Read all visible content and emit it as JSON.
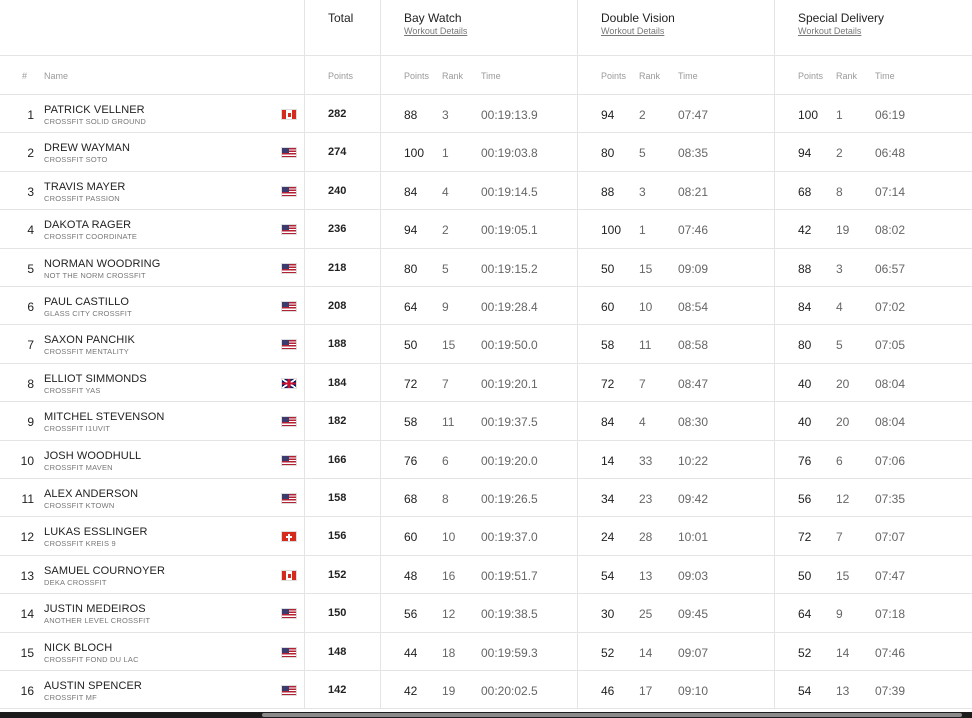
{
  "header": {
    "total_label": "Total",
    "events": [
      {
        "name": "Bay Watch",
        "link": "Workout Details"
      },
      {
        "name": "Double Vision",
        "link": "Workout Details"
      },
      {
        "name": "Special Delivery",
        "link": "Workout Details"
      }
    ]
  },
  "subheader": {
    "hash": "#",
    "name": "Name",
    "points": "Points",
    "ev_points": "Points",
    "ev_rank": "Rank",
    "ev_time": "Time"
  },
  "athletes": [
    {
      "rank": "1",
      "name": "PATRICK VELLNER",
      "affiliate": "CROSSFIT SOLID GROUND",
      "flag": "canada-flag",
      "total": "282",
      "events": [
        {
          "points": "88",
          "rank": "3",
          "time": "00:19:13.9"
        },
        {
          "points": "94",
          "rank": "2",
          "time": "07:47"
        },
        {
          "points": "100",
          "rank": "1",
          "time": "06:19"
        }
      ]
    },
    {
      "rank": "2",
      "name": "DREW WAYMAN",
      "affiliate": "CROSSFIT SOTO",
      "flag": "usa-flag",
      "total": "274",
      "events": [
        {
          "points": "100",
          "rank": "1",
          "time": "00:19:03.8"
        },
        {
          "points": "80",
          "rank": "5",
          "time": "08:35"
        },
        {
          "points": "94",
          "rank": "2",
          "time": "06:48"
        }
      ]
    },
    {
      "rank": "3",
      "name": "TRAVIS MAYER",
      "affiliate": "CROSSFIT PASSION",
      "flag": "usa-flag",
      "total": "240",
      "events": [
        {
          "points": "84",
          "rank": "4",
          "time": "00:19:14.5"
        },
        {
          "points": "88",
          "rank": "3",
          "time": "08:21"
        },
        {
          "points": "68",
          "rank": "8",
          "time": "07:14"
        }
      ]
    },
    {
      "rank": "4",
      "name": "DAKOTA RAGER",
      "affiliate": "CROSSFIT COORDINATE",
      "flag": "usa-flag",
      "total": "236",
      "events": [
        {
          "points": "94",
          "rank": "2",
          "time": "00:19:05.1"
        },
        {
          "points": "100",
          "rank": "1",
          "time": "07:46"
        },
        {
          "points": "42",
          "rank": "19",
          "time": "08:02"
        }
      ]
    },
    {
      "rank": "5",
      "name": "NORMAN WOODRING",
      "affiliate": "NOT THE NORM CROSSFIT",
      "flag": "usa-flag",
      "total": "218",
      "events": [
        {
          "points": "80",
          "rank": "5",
          "time": "00:19:15.2"
        },
        {
          "points": "50",
          "rank": "15",
          "time": "09:09"
        },
        {
          "points": "88",
          "rank": "3",
          "time": "06:57"
        }
      ]
    },
    {
      "rank": "6",
      "name": "PAUL CASTILLO",
      "affiliate": "GLASS CITY CROSSFIT",
      "flag": "usa-flag",
      "total": "208",
      "events": [
        {
          "points": "64",
          "rank": "9",
          "time": "00:19:28.4"
        },
        {
          "points": "60",
          "rank": "10",
          "time": "08:54"
        },
        {
          "points": "84",
          "rank": "4",
          "time": "07:02"
        }
      ]
    },
    {
      "rank": "7",
      "name": "SAXON PANCHIK",
      "affiliate": "CROSSFIT MENTALITY",
      "flag": "usa-flag",
      "total": "188",
      "events": [
        {
          "points": "50",
          "rank": "15",
          "time": "00:19:50.0"
        },
        {
          "points": "58",
          "rank": "11",
          "time": "08:58"
        },
        {
          "points": "80",
          "rank": "5",
          "time": "07:05"
        }
      ]
    },
    {
      "rank": "8",
      "name": "ELLIOT SIMMONDS",
      "affiliate": "CROSSFIT YAS",
      "flag": "uk-flag",
      "total": "184",
      "events": [
        {
          "points": "72",
          "rank": "7",
          "time": "00:19:20.1"
        },
        {
          "points": "72",
          "rank": "7",
          "time": "08:47"
        },
        {
          "points": "40",
          "rank": "20",
          "time": "08:04"
        }
      ]
    },
    {
      "rank": "9",
      "name": "MITCHEL STEVENSON",
      "affiliate": "CROSSFIT I1UVIT",
      "flag": "usa-flag",
      "total": "182",
      "events": [
        {
          "points": "58",
          "rank": "11",
          "time": "00:19:37.5"
        },
        {
          "points": "84",
          "rank": "4",
          "time": "08:30"
        },
        {
          "points": "40",
          "rank": "20",
          "time": "08:04"
        }
      ]
    },
    {
      "rank": "10",
      "name": "JOSH WOODHULL",
      "affiliate": "CROSSFIT MAVEN",
      "flag": "usa-flag",
      "total": "166",
      "events": [
        {
          "points": "76",
          "rank": "6",
          "time": "00:19:20.0"
        },
        {
          "points": "14",
          "rank": "33",
          "time": "10:22"
        },
        {
          "points": "76",
          "rank": "6",
          "time": "07:06"
        }
      ]
    },
    {
      "rank": "11",
      "name": "ALEX ANDERSON",
      "affiliate": "CROSSFIT KTOWN",
      "flag": "usa-flag",
      "total": "158",
      "events": [
        {
          "points": "68",
          "rank": "8",
          "time": "00:19:26.5"
        },
        {
          "points": "34",
          "rank": "23",
          "time": "09:42"
        },
        {
          "points": "56",
          "rank": "12",
          "time": "07:35"
        }
      ]
    },
    {
      "rank": "12",
      "name": "LUKAS ESSLINGER",
      "affiliate": "CROSSFIT KREIS 9",
      "flag": "switzerland-flag",
      "total": "156",
      "events": [
        {
          "points": "60",
          "rank": "10",
          "time": "00:19:37.0"
        },
        {
          "points": "24",
          "rank": "28",
          "time": "10:01"
        },
        {
          "points": "72",
          "rank": "7",
          "time": "07:07"
        }
      ]
    },
    {
      "rank": "13",
      "name": "SAMUEL COURNOYER",
      "affiliate": "DEKA CROSSFIT",
      "flag": "canada-flag",
      "total": "152",
      "events": [
        {
          "points": "48",
          "rank": "16",
          "time": "00:19:51.7"
        },
        {
          "points": "54",
          "rank": "13",
          "time": "09:03"
        },
        {
          "points": "50",
          "rank": "15",
          "time": "07:47"
        }
      ]
    },
    {
      "rank": "14",
      "name": "JUSTIN MEDEIROS",
      "affiliate": "ANOTHER LEVEL CROSSFIT",
      "flag": "usa-flag",
      "total": "150",
      "events": [
        {
          "points": "56",
          "rank": "12",
          "time": "00:19:38.5"
        },
        {
          "points": "30",
          "rank": "25",
          "time": "09:45"
        },
        {
          "points": "64",
          "rank": "9",
          "time": "07:18"
        }
      ]
    },
    {
      "rank": "15",
      "name": "NICK BLOCH",
      "affiliate": "CROSSFIT FOND DU LAC",
      "flag": "usa-flag",
      "total": "148",
      "events": [
        {
          "points": "44",
          "rank": "18",
          "time": "00:19:59.3"
        },
        {
          "points": "52",
          "rank": "14",
          "time": "09:07"
        },
        {
          "points": "52",
          "rank": "14",
          "time": "07:46"
        }
      ]
    },
    {
      "rank": "16",
      "name": "AUSTIN SPENCER",
      "affiliate": "CROSSFIT MF",
      "flag": "usa-flag",
      "total": "142",
      "events": [
        {
          "points": "42",
          "rank": "19",
          "time": "00:20:02.5"
        },
        {
          "points": "46",
          "rank": "17",
          "time": "09:10"
        },
        {
          "points": "54",
          "rank": "13",
          "time": "07:39"
        }
      ]
    }
  ]
}
